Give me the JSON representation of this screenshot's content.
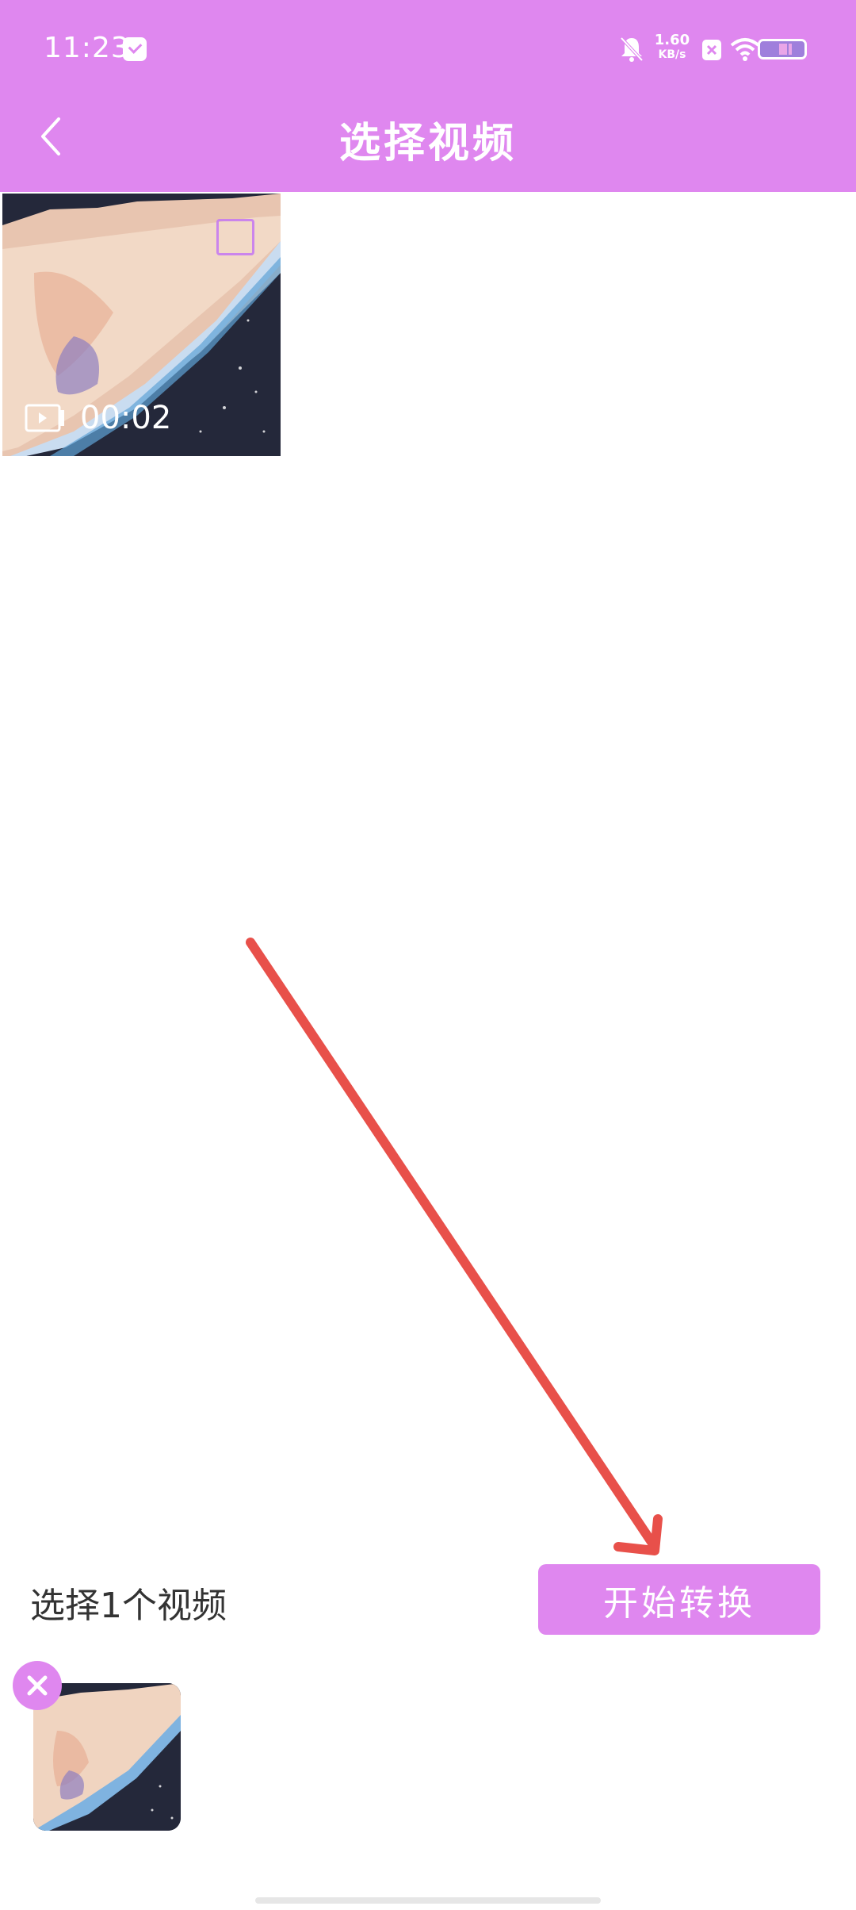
{
  "status_bar": {
    "time": "11:23",
    "net_speed_value": "1.60",
    "net_speed_unit": "KB/s"
  },
  "header": {
    "title": "选择视频",
    "bg_color": "#df87ef"
  },
  "videos": [
    {
      "duration": "00:02"
    }
  ],
  "selection": {
    "count_text": "选择1个视频",
    "start_button_label": "开始转换"
  },
  "colors": {
    "accent": "#df87ef",
    "annotation_arrow": "#e8504a"
  },
  "icons": {
    "back": "chevron-left-icon",
    "video_badge": "video-icon",
    "remove": "close-icon"
  }
}
